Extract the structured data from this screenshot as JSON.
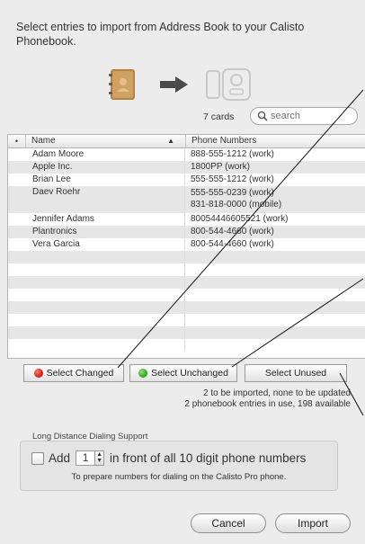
{
  "intro": "Select entries to import from Address Book to your Calisto Phonebook.",
  "icons": {
    "source": "address-book-icon",
    "arrow": "right-arrow-icon",
    "target": "phone-icon"
  },
  "search": {
    "count_label": "7 cards",
    "placeholder": "search"
  },
  "table": {
    "headers": {
      "sort_indicator": "•",
      "name": "Name",
      "sort_arrow": "▲",
      "phone": "Phone Numbers"
    },
    "rows": [
      {
        "name": "Adam Moore",
        "phones": [
          "888-555-1212 (work)"
        ]
      },
      {
        "name": "Apple Inc.",
        "phones": [
          "1800PP (work)"
        ]
      },
      {
        "name": "Brian Lee",
        "phones": [
          "555-555-1212 (work)"
        ]
      },
      {
        "name": "Daev Roehr",
        "phones": [
          "555-555-0239 (work)",
          "831-818-0000 (mobile)"
        ]
      },
      {
        "name": "Jennifer Adams",
        "phones": [
          "80054446605521 (work)"
        ]
      },
      {
        "name": "Plantronics",
        "phones": [
          "800-544-4660 (work)"
        ]
      },
      {
        "name": "Vera  Garcia",
        "phones": [
          "800-544-4660 (work)"
        ]
      }
    ]
  },
  "buttons": {
    "select_changed": "Select Changed",
    "select_unchanged": "Select Unchanged",
    "select_unused": "Select Unused",
    "cancel": "Cancel",
    "import": "Import"
  },
  "status": {
    "line1": "2 to be imported, none to be updated",
    "line2": "2 phonebook entries in use, 198 available"
  },
  "dialing": {
    "group_label": "Long Distance Dialing Support",
    "add_label": "Add",
    "stepper_value": "1",
    "suffix": "in front of all 10 digit phone numbers",
    "hint": "To prepare numbers for dialing on the Calisto Pro phone."
  },
  "colors": {
    "changed_dot": "#d1120b",
    "unchanged_dot": "#2aa318",
    "row_alt": "#e6e6e6"
  }
}
